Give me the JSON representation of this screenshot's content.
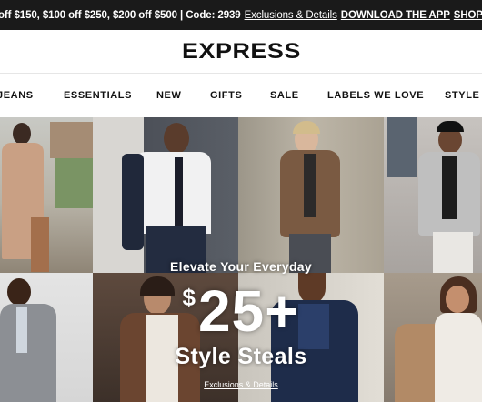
{
  "promo": {
    "offer_text": "off $150, $100 off $250, $200 off $500 | Code: 2939",
    "exclusions_link": "Exclusions & Details",
    "app_link": "DOWNLOAD THE APP",
    "shop_link": "SHOP NOW"
  },
  "header": {
    "logo": "EXPRESS"
  },
  "nav": {
    "items": [
      "JEANS",
      "ESSENTIALS",
      "NEW",
      "GIFTS",
      "SALE",
      "LABELS WE LOVE",
      "STYLE T"
    ]
  },
  "hero": {
    "subtitle": "Elevate Your Everyday",
    "price_symbol": "$",
    "price": "25+",
    "headline": "Style Steals",
    "link": "Exclusions & Details"
  },
  "colors": {
    "promo_bg": "#1a1a1a",
    "text": "#111111",
    "white": "#ffffff"
  }
}
